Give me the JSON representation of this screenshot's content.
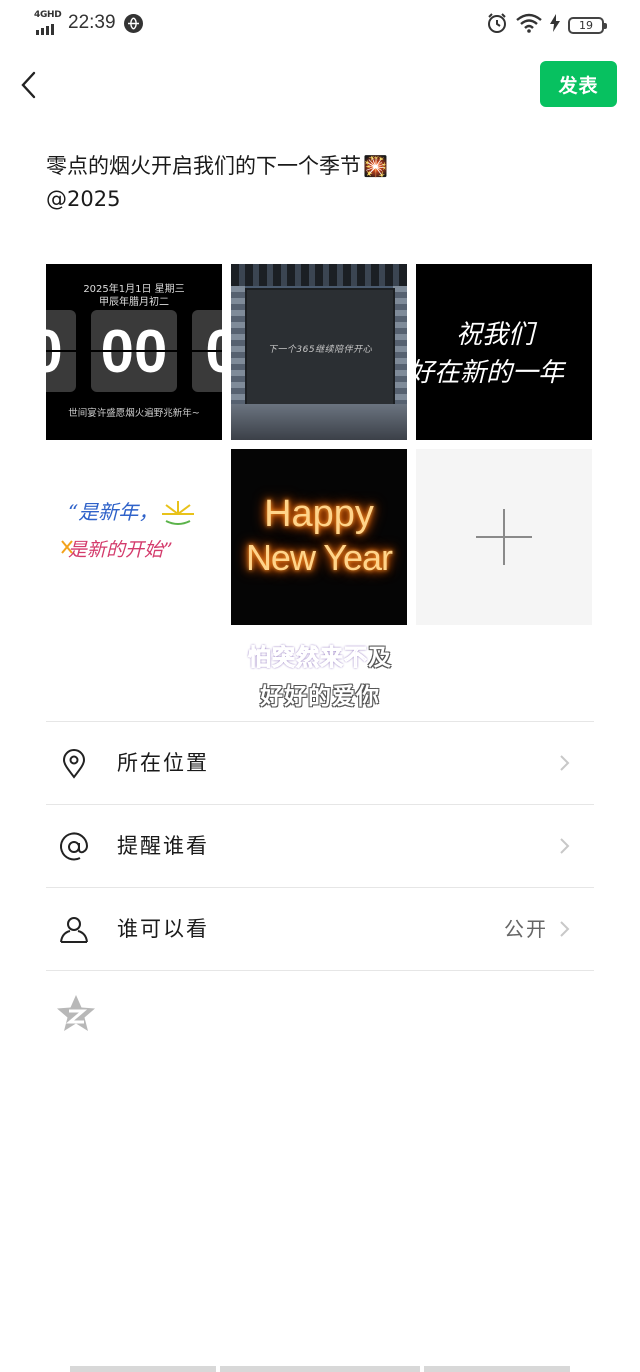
{
  "status_bar": {
    "network": "4GHD",
    "time": "22:39",
    "battery": "19"
  },
  "header": {
    "publish_label": "发表"
  },
  "post": {
    "caption_line1": "零点的烟火开启我们的下一个季节",
    "caption_emoji": "🎇",
    "caption_line2": "@2025"
  },
  "photos": {
    "p1": {
      "date_line1": "2025年1月1日 星期三",
      "date_line2": "甲辰年腊月初二",
      "digits": [
        "0",
        "00",
        "0"
      ],
      "footer": "世间宴许盛愿烟火遍野兆新年~"
    },
    "p2": {
      "screen_text": "下一个365继续陪伴开心"
    },
    "p3": {
      "line1": "祝我们",
      "line2": "好在新的一年"
    },
    "p4": {
      "line1": "“是新年，",
      "line2": "是新的开始”"
    },
    "p5": {
      "line1": "Happy",
      "line2": "New Year"
    }
  },
  "lyrics": {
    "line1_purple": "怕突然来不",
    "line1_white": "及",
    "line2": "好好的爱你"
  },
  "options": [
    {
      "icon": "location-pin-icon",
      "label": "所在位置",
      "value": ""
    },
    {
      "icon": "at-sign-icon",
      "label": "提醒谁看",
      "value": ""
    },
    {
      "icon": "person-icon",
      "label": "谁可以看",
      "value": "公开"
    }
  ],
  "colors": {
    "accent": "#07c160",
    "lyric_purple": "#7a2cf0"
  }
}
